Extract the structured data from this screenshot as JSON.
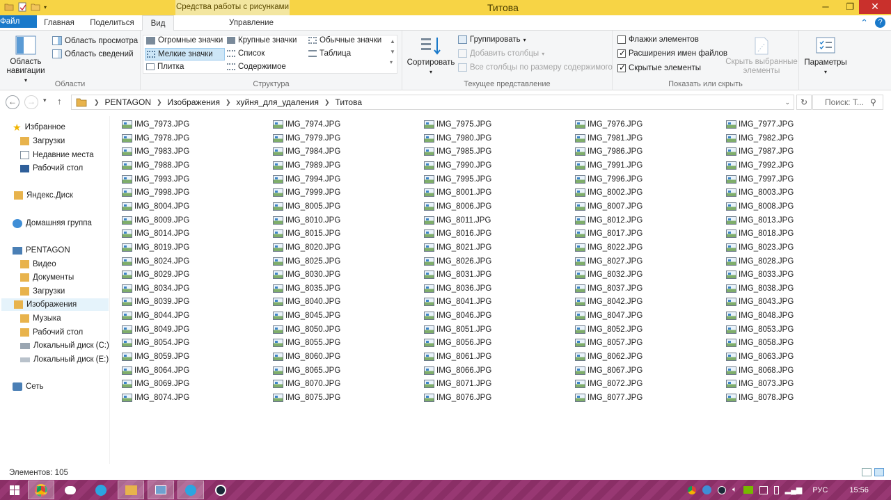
{
  "window": {
    "title": "Титова",
    "context_tab_group": "Средства работы с рисунками",
    "colors": {
      "titlebar": "#f7d445",
      "file_tab": "#1979ca",
      "close": "#c9302c",
      "taskbar": "#8a2f66"
    }
  },
  "tabs": {
    "file": "Файл",
    "home": "Главная",
    "share": "Поделиться",
    "view": "Вид",
    "manage": "Управление"
  },
  "ribbon": {
    "areas": {
      "nav_pane_line1": "Область",
      "nav_pane_line2": "навигации",
      "preview_pane": "Область просмотра",
      "details_pane": "Область сведений",
      "label": "Области"
    },
    "layout": {
      "huge_icons": "Огромные значки",
      "large_icons": "Крупные значки",
      "medium_icons": "Обычные значки",
      "small_icons": "Мелкие значки",
      "list": "Список",
      "details": "Таблица",
      "tiles": "Плитка",
      "content": "Содержимое",
      "label": "Структура",
      "selected": "Мелкие значки"
    },
    "current_view": {
      "sort": "Сортировать",
      "group_by": "Группировать",
      "add_columns": "Добавить столбцы",
      "size_all_columns": "Все столбцы по размеру содержимого",
      "label": "Текущее представление"
    },
    "show_hide": {
      "item_checkboxes": "Флажки элементов",
      "item_checkboxes_checked": false,
      "file_extensions": "Расширения имен файлов",
      "file_extensions_checked": true,
      "hidden_items": "Скрытые элементы",
      "hidden_items_checked": true,
      "hide_selected_line1": "Скрыть выбранные",
      "hide_selected_line2": "элементы",
      "label": "Показать или скрыть"
    },
    "options": "Параметры"
  },
  "address": {
    "crumbs": [
      "PENTAGON",
      "Изображения",
      "хуйня_для_удаления",
      "Титова"
    ],
    "search_placeholder": "Поиск: Т..."
  },
  "nav_pane": {
    "favorites": "Избранное",
    "downloads": "Загрузки",
    "recent": "Недавние места",
    "desktop": "Рабочий стол",
    "yandex_disk": "Яндекс.Диск",
    "homegroup": "Домашняя группа",
    "pc": "PENTAGON",
    "video": "Видео",
    "documents": "Документы",
    "pc_downloads": "Загрузки",
    "pictures": "Изображения",
    "music": "Музыка",
    "pc_desktop": "Рабочий стол",
    "disk_c": "Локальный диск (C:)",
    "disk_e": "Локальный диск (E:)",
    "network": "Сеть"
  },
  "files": [
    [
      "IMG_7973.JPG",
      "IMG_7974.JPG",
      "IMG_7975.JPG",
      "IMG_7976.JPG",
      "IMG_7977.JPG"
    ],
    [
      "IMG_7978.JPG",
      "IMG_7979.JPG",
      "IMG_7980.JPG",
      "IMG_7981.JPG",
      "IMG_7982.JPG"
    ],
    [
      "IMG_7983.JPG",
      "IMG_7984.JPG",
      "IMG_7985.JPG",
      "IMG_7986.JPG",
      "IMG_7987.JPG"
    ],
    [
      "IMG_7988.JPG",
      "IMG_7989.JPG",
      "IMG_7990.JPG",
      "IMG_7991.JPG",
      "IMG_7992.JPG"
    ],
    [
      "IMG_7993.JPG",
      "IMG_7994.JPG",
      "IMG_7995.JPG",
      "IMG_7996.JPG",
      "IMG_7997.JPG"
    ],
    [
      "IMG_7998.JPG",
      "IMG_7999.JPG",
      "IMG_8001.JPG",
      "IMG_8002.JPG",
      "IMG_8003.JPG"
    ],
    [
      "IMG_8004.JPG",
      "IMG_8005.JPG",
      "IMG_8006.JPG",
      "IMG_8007.JPG",
      "IMG_8008.JPG"
    ],
    [
      "IMG_8009.JPG",
      "IMG_8010.JPG",
      "IMG_8011.JPG",
      "IMG_8012.JPG",
      "IMG_8013.JPG"
    ],
    [
      "IMG_8014.JPG",
      "IMG_8015.JPG",
      "IMG_8016.JPG",
      "IMG_8017.JPG",
      "IMG_8018.JPG"
    ],
    [
      "IMG_8019.JPG",
      "IMG_8020.JPG",
      "IMG_8021.JPG",
      "IMG_8022.JPG",
      "IMG_8023.JPG"
    ],
    [
      "IMG_8024.JPG",
      "IMG_8025.JPG",
      "IMG_8026.JPG",
      "IMG_8027.JPG",
      "IMG_8028.JPG"
    ],
    [
      "IMG_8029.JPG",
      "IMG_8030.JPG",
      "IMG_8031.JPG",
      "IMG_8032.JPG",
      "IMG_8033.JPG"
    ],
    [
      "IMG_8034.JPG",
      "IMG_8035.JPG",
      "IMG_8036.JPG",
      "IMG_8037.JPG",
      "IMG_8038.JPG"
    ],
    [
      "IMG_8039.JPG",
      "IMG_8040.JPG",
      "IMG_8041.JPG",
      "IMG_8042.JPG",
      "IMG_8043.JPG"
    ],
    [
      "IMG_8044.JPG",
      "IMG_8045.JPG",
      "IMG_8046.JPG",
      "IMG_8047.JPG",
      "IMG_8048.JPG"
    ],
    [
      "IMG_8049.JPG",
      "IMG_8050.JPG",
      "IMG_8051.JPG",
      "IMG_8052.JPG",
      "IMG_8053.JPG"
    ],
    [
      "IMG_8054.JPG",
      "IMG_8055.JPG",
      "IMG_8056.JPG",
      "IMG_8057.JPG",
      "IMG_8058.JPG"
    ],
    [
      "IMG_8059.JPG",
      "IMG_8060.JPG",
      "IMG_8061.JPG",
      "IMG_8062.JPG",
      "IMG_8063.JPG"
    ],
    [
      "IMG_8064.JPG",
      "IMG_8065.JPG",
      "IMG_8066.JPG",
      "IMG_8067.JPG",
      "IMG_8068.JPG"
    ],
    [
      "IMG_8069.JPG",
      "IMG_8070.JPG",
      "IMG_8071.JPG",
      "IMG_8072.JPG",
      "IMG_8073.JPG"
    ],
    [
      "IMG_8074.JPG",
      "IMG_8075.JPG",
      "IMG_8076.JPG",
      "IMG_8077.JPG",
      "IMG_8078.JPG"
    ]
  ],
  "status": {
    "item_count": "Элементов: 105"
  },
  "taskbar": {
    "language": "РУС",
    "time": "15:56",
    "apps": [
      "start-icon",
      "chrome-icon",
      "discord-icon",
      "telegram-icon",
      "explorer-icon",
      "photo-viewer-icon",
      "telegram-icon",
      "steam-icon"
    ]
  }
}
